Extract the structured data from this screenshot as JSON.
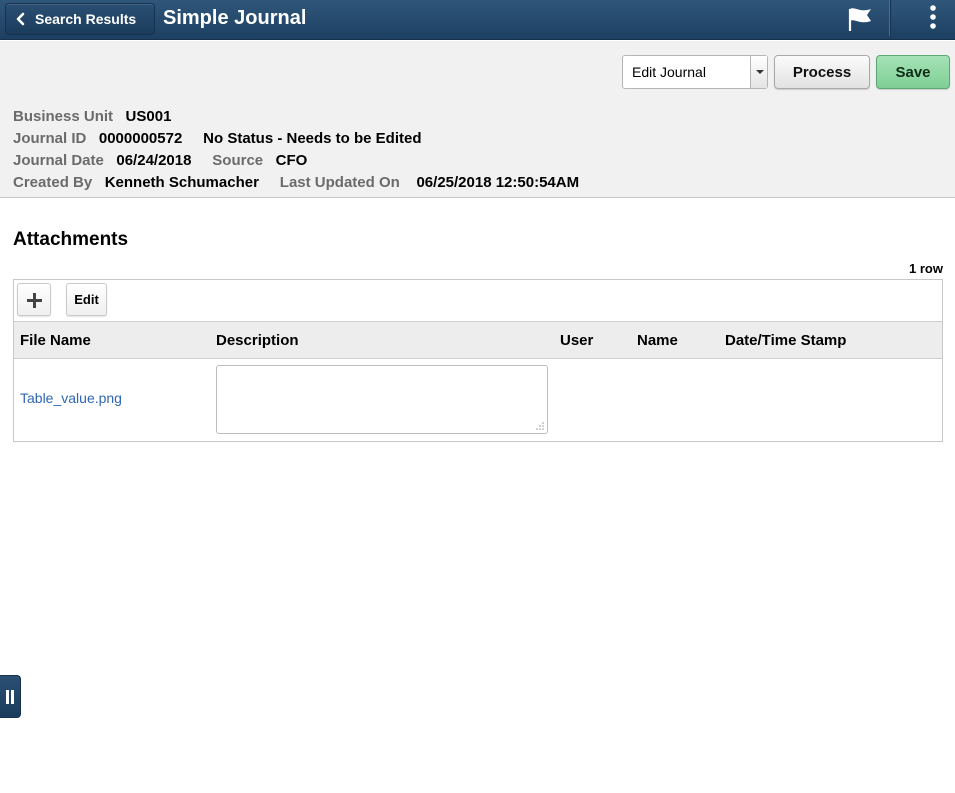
{
  "header": {
    "back_label": "Search Results",
    "title": "Simple Journal",
    "icons": [
      "chevron-left-icon",
      "flag-icon",
      "more-vertical-icon"
    ]
  },
  "toolbar": {
    "action_select": {
      "selected": "Edit Journal"
    },
    "process_label": "Process",
    "save_label": "Save",
    "colors": {
      "save_bg": "#8fd7a3",
      "header_bg": "#25496c"
    }
  },
  "journal_info": {
    "business_unit": {
      "label": "Business Unit",
      "value": "US001"
    },
    "journal_id": {
      "label": "Journal ID",
      "value": "0000000572"
    },
    "status": "No Status - Needs to be Edited",
    "journal_date": {
      "label": "Journal Date",
      "value": "06/24/2018"
    },
    "source": {
      "label": "Source",
      "value": "CFO"
    },
    "created_by": {
      "label": "Created By",
      "value": "Kenneth Schumacher"
    },
    "last_updated_on": {
      "label": "Last Updated On",
      "value": "06/25/2018 12:50:54AM"
    }
  },
  "attachments": {
    "title": "Attachments",
    "row_count": "1 row",
    "add_icon": "plus-icon",
    "edit_label": "Edit",
    "columns": [
      "File Name",
      "Description",
      "User",
      "Name",
      "Date/Time Stamp"
    ],
    "rows": [
      {
        "file_name": "Table_value.png",
        "description": "",
        "user": "",
        "name": "",
        "date_time_stamp": ""
      }
    ]
  },
  "side_tab": {
    "icon": "pin-icon"
  }
}
